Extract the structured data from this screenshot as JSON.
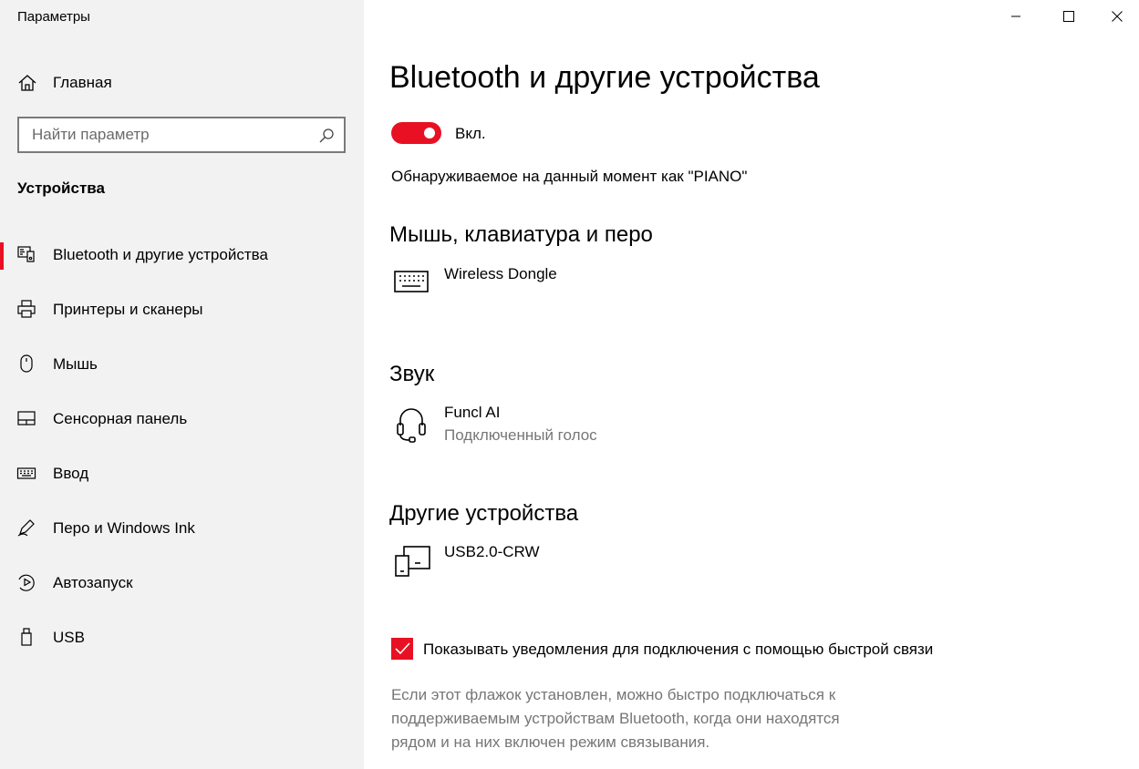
{
  "window": {
    "title": "Параметры"
  },
  "sidebar": {
    "home_label": "Главная",
    "search_placeholder": "Найти параметр",
    "section": "Устройства",
    "items": [
      {
        "label": "Bluetooth и другие устройства",
        "icon": "bluetooth-devices-icon",
        "active": true
      },
      {
        "label": "Принтеры и сканеры",
        "icon": "printer-icon"
      },
      {
        "label": "Мышь",
        "icon": "mouse-icon"
      },
      {
        "label": "Сенсорная панель",
        "icon": "touchpad-icon"
      },
      {
        "label": "Ввод",
        "icon": "keyboard-icon"
      },
      {
        "label": "Перо и Windows Ink",
        "icon": "pen-icon"
      },
      {
        "label": "Автозапуск",
        "icon": "autoplay-icon"
      },
      {
        "label": "USB",
        "icon": "usb-icon"
      }
    ]
  },
  "main": {
    "title": "Bluetooth и другие устройства",
    "toggle_label": "Вкл.",
    "discoverable": "Обнаруживаемое на данный момент как \"PIANO\"",
    "groups": [
      {
        "title": "Мышь, клавиатура и перо",
        "devices": [
          {
            "name": "Wireless Dongle",
            "icon": "keyboard-icon"
          }
        ]
      },
      {
        "title": "Звук",
        "devices": [
          {
            "name": "Funcl AI",
            "status": "Подключенный голос",
            "icon": "headset-icon"
          }
        ]
      },
      {
        "title": "Другие устройства",
        "devices": [
          {
            "name": "USB2.0-CRW",
            "icon": "generic-device-icon"
          }
        ]
      }
    ],
    "swift_pair": {
      "label": "Показывать уведомления для подключения с помощью быстрой связи",
      "description": "Если этот флажок установлен, можно быстро подключаться к поддерживаемым устройствам Bluetooth, когда они находятся рядом и на них включен режим связывания."
    }
  },
  "colors": {
    "accent": "#e81123",
    "sidebar_bg": "#f2f2f2",
    "secondary_text": "#767676"
  }
}
